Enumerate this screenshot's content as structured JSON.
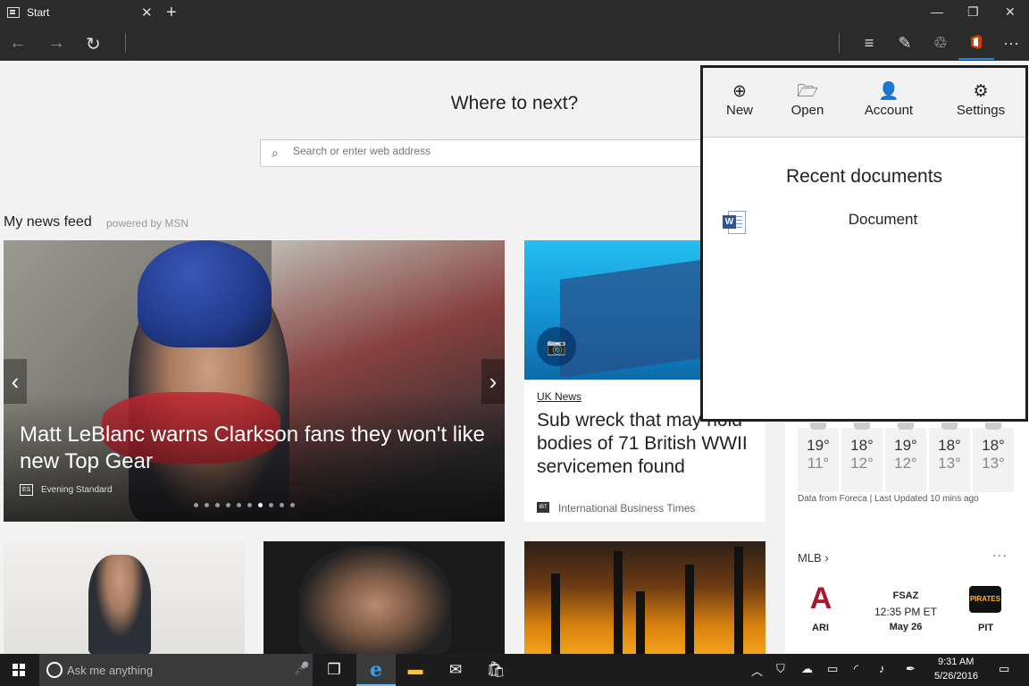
{
  "browser": {
    "tab_title": "Start",
    "tab_close": "✕",
    "new_tab": "+",
    "minimize": "—",
    "maximize": "❐",
    "close": "✕"
  },
  "nav": {
    "back": "←",
    "forward": "→",
    "refresh": "↻",
    "hub": "≡",
    "notes": "✎",
    "share": "♲",
    "more": "···"
  },
  "start_page": {
    "heading": "Where to next?",
    "search_placeholder": "Search or enter web address",
    "feed_title": "My news feed",
    "powered_by": "powered by MSN"
  },
  "hero": {
    "headline": "Matt LeBlanc warns Clarkson fans they won't like new Top Gear",
    "source": "Evening Standard",
    "source_icon": "ES",
    "prev": "‹",
    "next": "›",
    "slides": 10,
    "active_slide": 7
  },
  "card2": {
    "tag": "UK News",
    "headline": "Sub wreck that may hold bodies of 71 British WWII servicemen found",
    "source": "International Business Times",
    "source_icon": "IBT"
  },
  "weather": {
    "days": [
      {
        "hi": "19°",
        "lo": "11°"
      },
      {
        "hi": "18°",
        "lo": "12°"
      },
      {
        "hi": "19°",
        "lo": "12°"
      },
      {
        "hi": "18°",
        "lo": "13°"
      },
      {
        "hi": "18°",
        "lo": "13°"
      }
    ],
    "note": "Data from Foreca | Last Updated 10 mins ago"
  },
  "mlb": {
    "title": "MLB",
    "chevron": "›",
    "more": "···",
    "team1": "ARI",
    "team1_logo": "A",
    "status": "FSAZ",
    "time": "12:35 PM ET",
    "date": "May 26",
    "team2": "PIT",
    "team2_logo": "PIRATES"
  },
  "office": {
    "buttons": [
      {
        "label": "New",
        "icon": "⊕"
      },
      {
        "label": "Open",
        "icon": "🗁"
      },
      {
        "label": "Account",
        "icon": "👤"
      },
      {
        "label": "Settings",
        "icon": "⚙"
      }
    ],
    "recent_title": "Recent documents",
    "documents": [
      {
        "name": "Document",
        "icon_letter": "W"
      }
    ],
    "accent": "#d83b01"
  },
  "taskbar": {
    "search_placeholder": "Ask me anything",
    "mic": "🎤",
    "task_view": "❐",
    "edge": "e",
    "explorer": "▬",
    "mail": "✉",
    "store": "🛍",
    "chevron_up": "︿",
    "time": "9:31 AM",
    "date": "5/26/2016",
    "notifications": "▭"
  }
}
